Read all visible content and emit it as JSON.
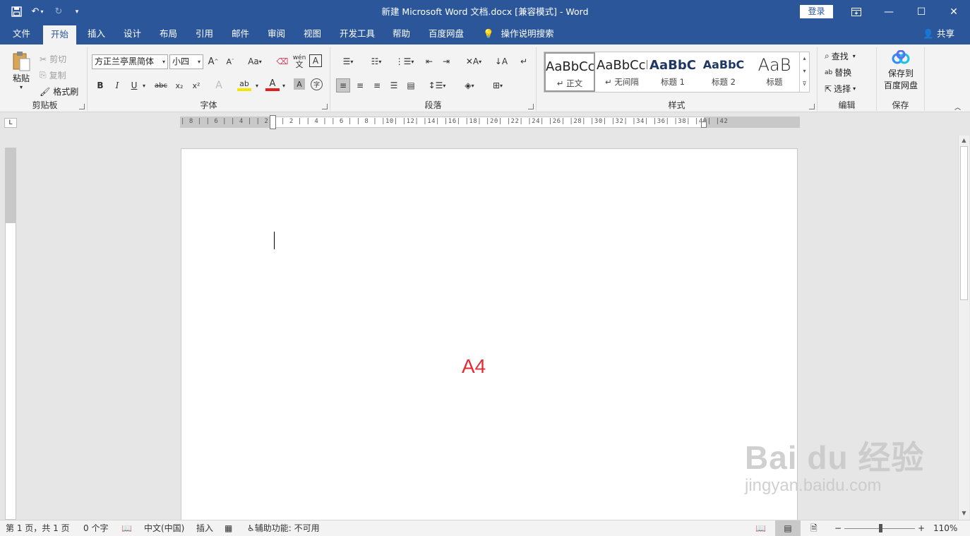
{
  "window": {
    "title": "新建 Microsoft Word 文档.docx [兼容模式]  -  Word",
    "login": "登录",
    "save_icon": "save-icon",
    "undo_icon": "undo-icon",
    "redo_icon": "redo-icon",
    "customize_icon": "customize-qat-icon"
  },
  "tabs": [
    {
      "label": "文件"
    },
    {
      "label": "开始"
    },
    {
      "label": "插入"
    },
    {
      "label": "设计"
    },
    {
      "label": "布局"
    },
    {
      "label": "引用"
    },
    {
      "label": "邮件"
    },
    {
      "label": "审阅"
    },
    {
      "label": "视图"
    },
    {
      "label": "开发工具"
    },
    {
      "label": "帮助"
    },
    {
      "label": "百度网盘"
    },
    {
      "label": "操作说明搜索"
    }
  ],
  "share": "共享",
  "clipboard": {
    "paste": "粘贴",
    "cut": "剪切",
    "copy": "复制",
    "format_painter": "格式刷",
    "label": "剪贴板"
  },
  "font": {
    "name": "方正兰亭黑简体",
    "size": "小四",
    "label": "字体",
    "grow": "A",
    "shrink": "A",
    "case": "Aa",
    "phonetic": "wén",
    "border_char": "A",
    "bold": "B",
    "italic": "I",
    "underline": "U",
    "strike": "abc",
    "sub": "x₂",
    "sup": "x²",
    "effects": "A",
    "highlight": "ab",
    "color": "A",
    "shade": "A",
    "enclose": "字"
  },
  "paragraph": {
    "label": "段落"
  },
  "styles": {
    "label": "样式",
    "items": [
      {
        "preview": "AaBbCcDd",
        "name": "↵ 正文"
      },
      {
        "preview": "AaBbCcDd",
        "name": "↵ 无间隔"
      },
      {
        "preview": "AaBbC",
        "name": "标题 1"
      },
      {
        "preview": "AaBbC",
        "name": "标题 2"
      },
      {
        "preview": "AaB",
        "name": "标题"
      }
    ]
  },
  "editing": {
    "label": "编辑",
    "find": "查找",
    "replace": "替换",
    "select": "选择"
  },
  "save_group": {
    "line1": "保存到",
    "line2": "百度网盘",
    "label": "保存"
  },
  "ruler": {
    "ticks": "| 8 |  | 6 |  | 4 |  | 2 |     | 2 |  | 4 |  | 6 |  | 8 |  |10|  |12|  |14|  |16|  |18|  |20|  |22|  |24|  |26|  |28|  |30|  |32|  |34|  |36|  |38|  |40|  |42",
    "corner": "L"
  },
  "document": {
    "text": "A4"
  },
  "status": {
    "page": "第 1 页，共 1 页",
    "words": "0 个字",
    "language": "中文(中国)",
    "mode": "插入",
    "accessibility": "辅助功能: 不可用",
    "zoom": "110%"
  },
  "watermark": {
    "logo": "Bai  du 经验",
    "url": "jingyan.baidu.com"
  },
  "colors": {
    "titlebar": "#2b579a",
    "accent_red": "#e22d35"
  }
}
